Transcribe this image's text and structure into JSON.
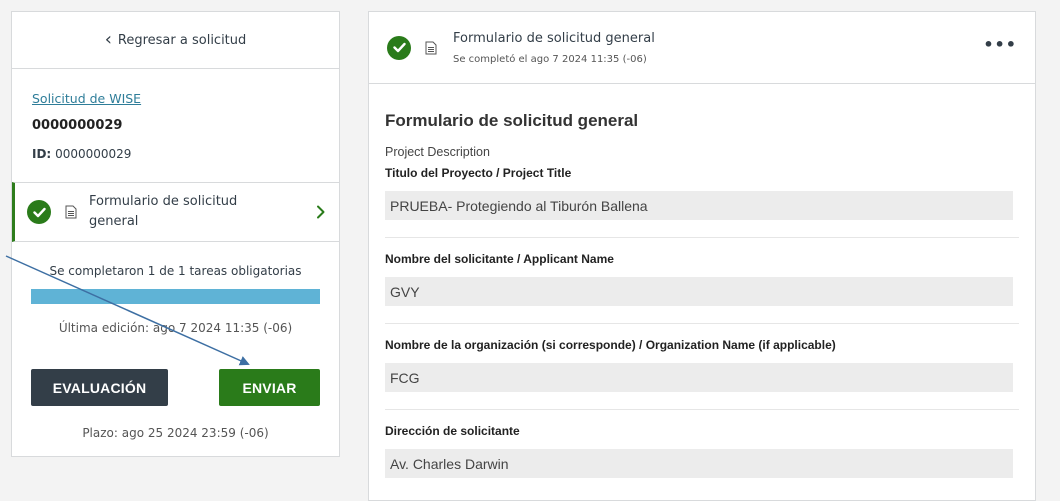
{
  "colors": {
    "accent_green": "#2a7b1a",
    "progress_blue": "#5fb3d6",
    "dark_button": "#333e48",
    "link": "#2e7d99"
  },
  "sidebar": {
    "back_label": "Regresar a solicitud",
    "back_icon": "chevron-left-icon",
    "application_link": "Solicitud de WISE",
    "application_number": "0000000029",
    "id_label": "ID:",
    "id_value": "0000000029",
    "task": {
      "label": "Formulario de solicitud general",
      "status_icon": "check-circle-icon",
      "type_icon": "document-icon",
      "chevron": "chevron-right-icon"
    },
    "progress_text": "Se completaron 1 de 1 tareas obligatorias",
    "progress_fraction": 1.0,
    "last_edit": "Última edición: ago 7 2024 11:35 (-06)",
    "evaluation_button": "EVALUACIÓN",
    "send_button": "ENVIAR",
    "deadline": "Plazo: ago 25 2024 23:59 (-06)"
  },
  "form": {
    "header_title": "Formulario de solicitud general",
    "header_subtitle": "Se completó el ago 7 2024 11:35 (-06)",
    "more_icon": "more-horizontal-icon",
    "title": "Formulario de solicitud general",
    "section": "Project Description",
    "fields": [
      {
        "label": "Titulo del Proyecto / Project Title",
        "value": "PRUEBA- Protegiendo al Tiburón Ballena"
      },
      {
        "label": "Nombre del solicitante / Applicant Name",
        "value": "GVY"
      },
      {
        "label": "Nombre de la organización (si corresponde) / Organization Name (if applicable)",
        "value": "FCG"
      },
      {
        "label": "Dirección de solicitante",
        "value": "Av. Charles Darwin"
      }
    ]
  }
}
